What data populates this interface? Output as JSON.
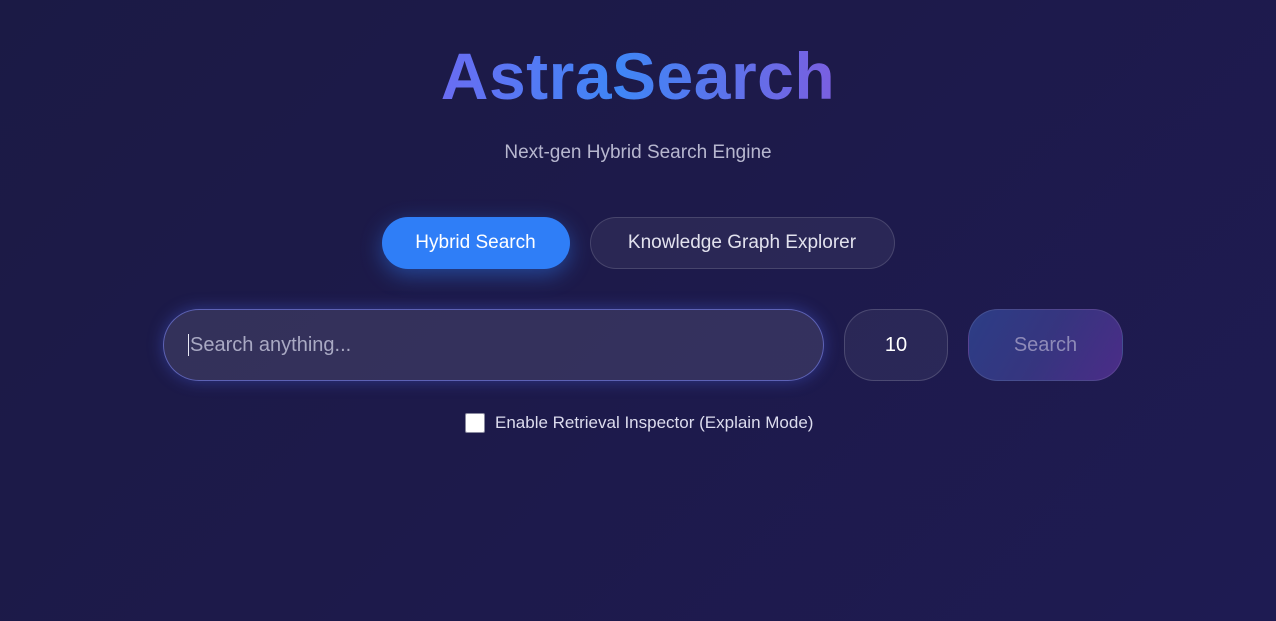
{
  "app": {
    "title": "AstraSearch",
    "subtitle": "Next-gen Hybrid Search Engine"
  },
  "tabs": [
    {
      "label": "Hybrid Search",
      "active": true
    },
    {
      "label": "Knowledge Graph Explorer",
      "active": false
    }
  ],
  "search": {
    "placeholder": "Search anything...",
    "value": "",
    "result_count": "10",
    "button_label": "Search"
  },
  "explain": {
    "label": "Enable Retrieval Inspector (Explain Mode)",
    "checked": false
  },
  "colors": {
    "accent": "#2f7ef7",
    "background": "#1c1a48"
  }
}
